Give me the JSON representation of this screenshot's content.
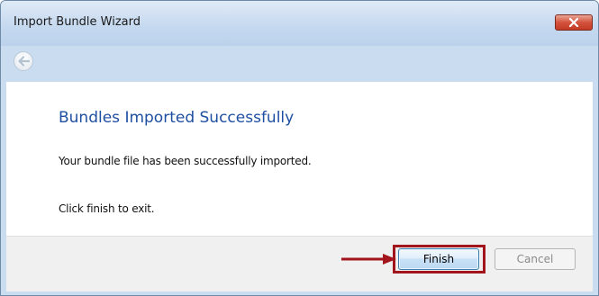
{
  "window": {
    "title": "Import Bundle Wizard"
  },
  "content": {
    "heading": "Bundles Imported Successfully",
    "message": "Your bundle file has been successfully imported.",
    "exit_instruction": "Click finish to exit."
  },
  "footer": {
    "finish_label": "Finish",
    "cancel_label": "Cancel"
  },
  "icons": {
    "close": "close-icon",
    "back": "back-arrow-icon",
    "pointer": "arrow-right-icon"
  },
  "colors": {
    "heading": "#1e4fa1",
    "highlight": "#a3151c",
    "close_button": "#d4523c"
  }
}
